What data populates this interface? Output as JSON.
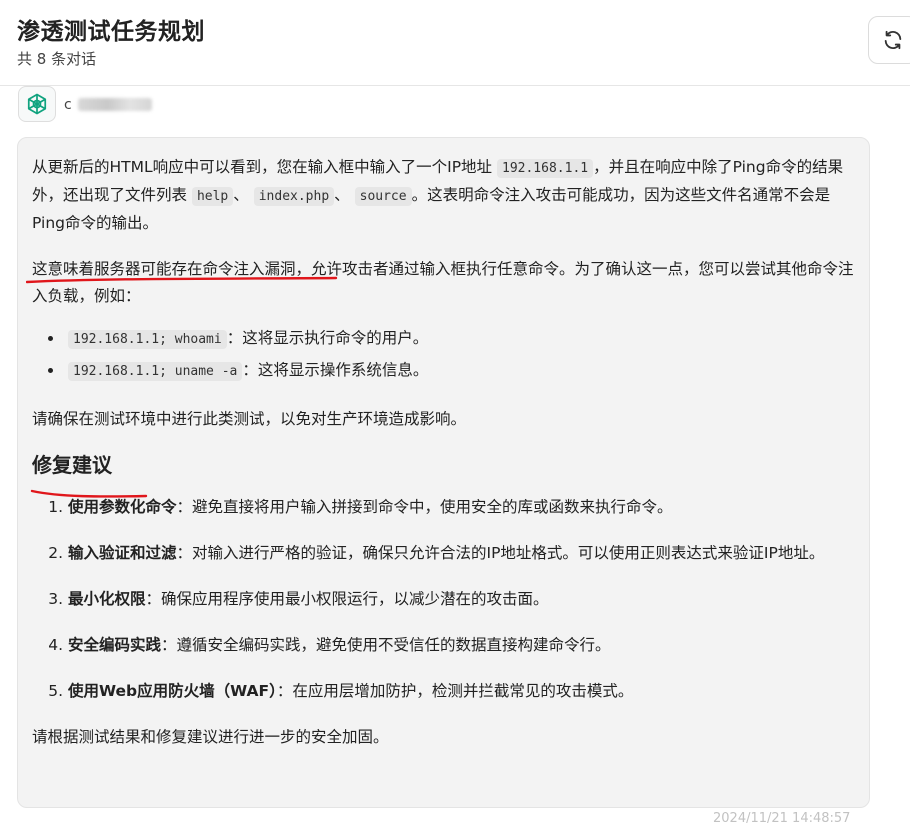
{
  "header": {
    "title": "渗透测试任务规划",
    "subtitle": "共 8 条对话"
  },
  "icons": {
    "refresh": "refresh-icon",
    "avatar": "openai-logo-icon"
  },
  "message": {
    "sender_initial": "c",
    "timestamp": "2024/11/21 14:48:57",
    "para1": {
      "t1": "从更新后的HTML响应中可以看到，您在输入框中输入了一个IP地址",
      "c1": "192.168.1.1",
      "t2": "，并且在响应中除了Ping命令的结果外，还出现了文件列表",
      "c2": "help",
      "t3": "、",
      "c3": "index.php",
      "t4": "、",
      "c4": "source",
      "t5": "。这表明命令注入攻击可能成功，因为这些文件名通常不会是Ping命令的输出。"
    },
    "para2": {
      "highlight": "这意味着服务器可能存在命令注入漏洞",
      "rest": "，允许攻击者通过输入框执行任意命令。为了确认这一点，您可以尝试其他命令注入负载，例如："
    },
    "bullets": [
      {
        "code": "192.168.1.1; whoami",
        "text": "：这将显示执行命令的用户。"
      },
      {
        "code": "192.168.1.1; uname -a",
        "text": "：这将显示操作系统信息。"
      }
    ],
    "para3": "请确保在测试环境中进行此类测试，以免对生产环境造成影响。",
    "heading": "修复建议",
    "steps": [
      {
        "num": "1.",
        "bold": "使用参数化命令",
        "text": "：避免直接将用户输入拼接到命令中，使用安全的库或函数来执行命令。"
      },
      {
        "num": "2.",
        "bold": "输入验证和过滤",
        "text": "：对输入进行严格的验证，确保只允许合法的IP地址格式。可以使用正则表达式来验证IP地址。"
      },
      {
        "num": "3.",
        "bold": "最小化权限",
        "text": "：确保应用程序使用最小权限运行，以减少潜在的攻击面。"
      },
      {
        "num": "4.",
        "bold": "安全编码实践",
        "text": "：遵循安全编码实践，避免使用不受信任的数据直接构建命令行。"
      },
      {
        "num": "5.",
        "bold": "使用Web应用防火墙（WAF）",
        "text": "：在应用层增加防护，检测并拦截常见的攻击模式。"
      }
    ],
    "closing": "请根据测试结果和修复建议进行进一步的安全加固。"
  },
  "colors": {
    "annotation": "#e0161b",
    "bubble_bg": "#f3f3f3",
    "openai_logo": "#10a37f"
  }
}
